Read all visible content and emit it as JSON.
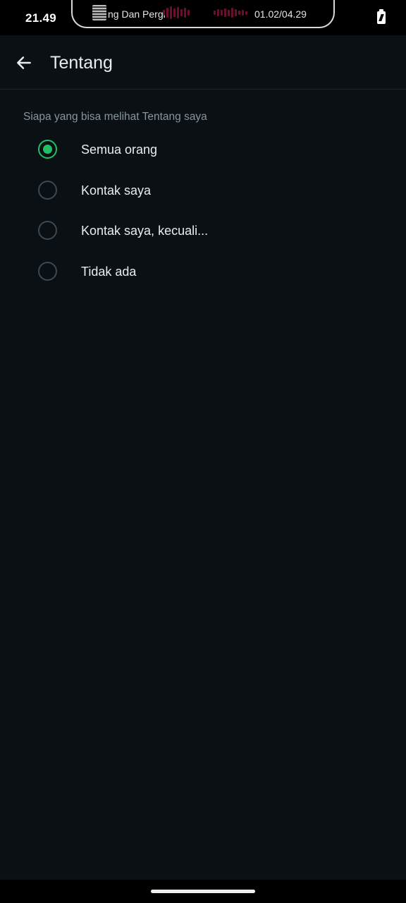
{
  "status_bar": {
    "time": "21.49",
    "media": {
      "title": "ng Dan Pergi",
      "position": "01.02/04.29"
    },
    "battery_icon": "battery-charging-icon"
  },
  "app_bar": {
    "back_icon": "arrow-left-icon",
    "title": "Tentang"
  },
  "privacy": {
    "section_label": "Siapa yang bisa melihat Tentang saya",
    "options": [
      {
        "label": "Semua orang",
        "selected": true
      },
      {
        "label": "Kontak saya",
        "selected": false
      },
      {
        "label": "Kontak saya, kecuali...",
        "selected": false
      },
      {
        "label": "Tidak ada",
        "selected": false
      }
    ]
  },
  "colors": {
    "background": "#0b1014",
    "accent": "#21c063",
    "radio_unchecked": "#3b4a54",
    "secondary_text": "#8696a0"
  }
}
